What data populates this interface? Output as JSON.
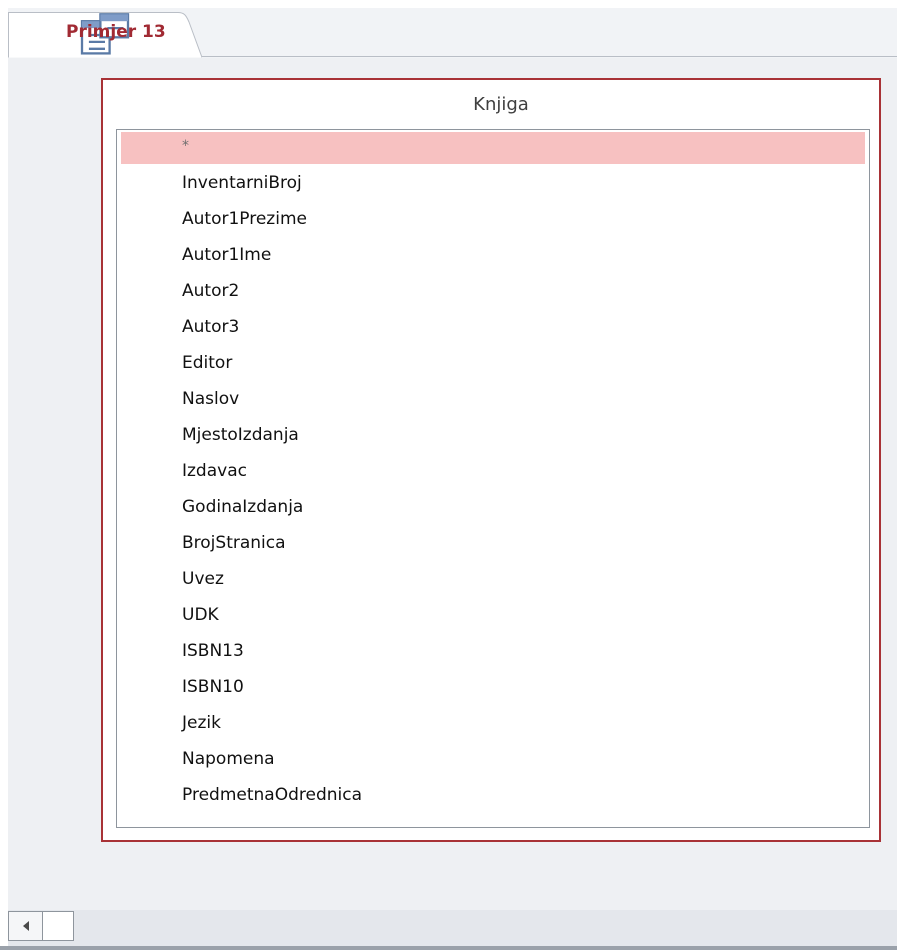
{
  "document_tab": {
    "title": "Primjer 13",
    "icon": "query-design-icon"
  },
  "field_list": {
    "title": "Knjiga",
    "fields": [
      "*",
      "InventarniBroj",
      "Autor1Prezime",
      "Autor1Ime",
      "Autor2",
      "Autor3",
      "Editor",
      "Naslov",
      "MjestoIzdanja",
      "Izdavac",
      "GodinaIzdanja",
      "BrojStranica",
      "Uvez",
      "UDK",
      "ISBN13",
      "ISBN10",
      "Jezik",
      "Napomena",
      "PredmetnaOdrednica"
    ],
    "selected_field": "*"
  },
  "horizontal_scrollbar": {
    "left_arrow_icon": "arrow-left-icon"
  },
  "colors": {
    "tab_title": "#a12a33",
    "field_list_border": "#a83236",
    "selected_row": "#f7c1c1",
    "workspace": "#eef0f3"
  }
}
